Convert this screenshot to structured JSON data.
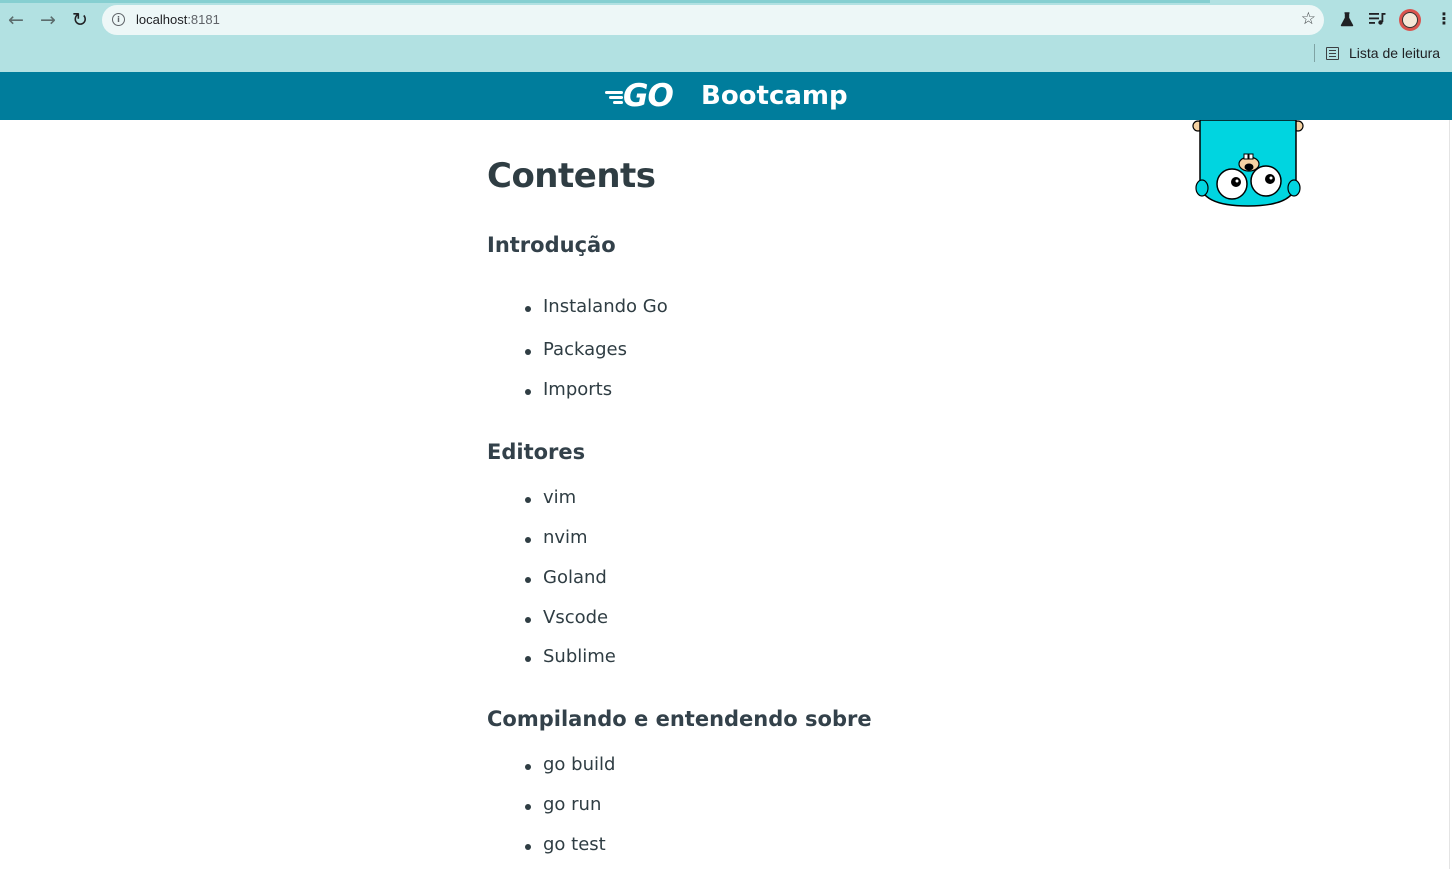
{
  "browser": {
    "url_host": "localhost",
    "url_port": ":8181",
    "reading_list_label": "Lista de leitura"
  },
  "header": {
    "logo_text": "GO",
    "title": "Bootcamp"
  },
  "main": {
    "heading": "Contents",
    "sections": [
      {
        "title": "Introdução",
        "items": [
          "Instalando Go",
          "Packages",
          "Imports"
        ]
      },
      {
        "title": "Editores",
        "items": [
          "vim",
          "nvim",
          "Goland",
          "Vscode",
          "Sublime"
        ]
      },
      {
        "title": "Compilando e entendendo sobre",
        "items": [
          "go build",
          "go run",
          "go test"
        ]
      }
    ]
  },
  "colors": {
    "chrome": "#b2e1e2",
    "header_bg": "#007d9c",
    "text": "#2f3d43",
    "gopher": "#00d5e0"
  },
  "icons": {
    "back": "arrow-left-icon",
    "forward": "arrow-right-icon",
    "reload": "reload-icon",
    "site_info": "info-icon",
    "bookmark": "star-icon",
    "labs": "flask-icon",
    "media": "media-queue-icon",
    "profile": "avatar",
    "menu": "kebab-menu-icon",
    "reading_list": "reading-list-icon"
  }
}
